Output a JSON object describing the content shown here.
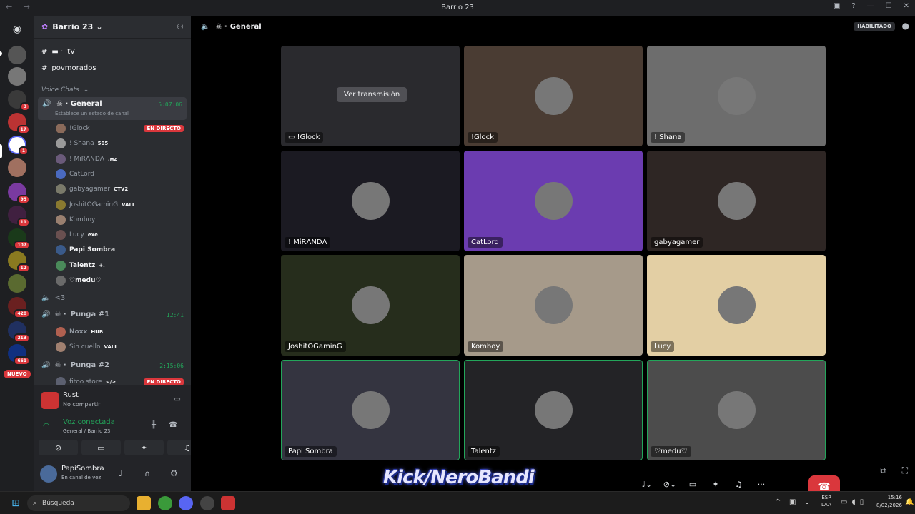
{
  "window": {
    "title": "Barrio 23",
    "nav": "← →"
  },
  "server": {
    "name": "Barrio 23"
  },
  "channels": {
    "text1": "tV",
    "text2": "povmorados",
    "category": "Voice Chats",
    "lowest": "<3"
  },
  "general": {
    "name": "General",
    "time": "5:07:06",
    "status": "Establece un estado de canal",
    "live": "EN DIRECTO"
  },
  "voice_users": [
    {
      "name": "!Glock",
      "tag": "",
      "live": "EN DIRECTO"
    },
    {
      "name": "! Shana",
      "tag": "505"
    },
    {
      "name": "! MiRΛNDΛ",
      "tag": ".ᴍᴢ"
    },
    {
      "name": "CatLord",
      "tag": ""
    },
    {
      "name": "gabyagamer",
      "tag": "CTV2"
    },
    {
      "name": "JoshitOGaminG",
      "tag": "VALL"
    },
    {
      "name": "Komboy",
      "tag": ""
    },
    {
      "name": "Lucy",
      "tag": "exe"
    },
    {
      "name": "Papi Sombra",
      "tag": ""
    },
    {
      "name": "Talentz",
      "tag": "+."
    },
    {
      "name": "♡medu♡",
      "tag": ""
    }
  ],
  "punga1": {
    "name": "Punga #1",
    "time": "12:41",
    "users": [
      {
        "name": "Noxx",
        "tag": "HUB"
      },
      {
        "name": "Sin cuello",
        "tag": "VALL"
      }
    ]
  },
  "punga2": {
    "name": "Punga #2",
    "time": "2:15:06",
    "users": [
      {
        "name": "fitoo store",
        "tag": "</>",
        "live": "EN DIRECTO"
      }
    ]
  },
  "rail_badges": [
    "3",
    "17",
    "1",
    "95",
    "11",
    "107",
    "12",
    "420",
    "213",
    "661"
  ],
  "rail_new": "NUEVO",
  "activity": {
    "name": "Rust",
    "sub": "No compartir"
  },
  "voice_status": {
    "title": "Voz conectada",
    "channel": "General / Barrio 23"
  },
  "user": {
    "name": "PapiSombra",
    "status": "En canal de voz"
  },
  "main": {
    "channel": "General",
    "enabled": "HABILITADO",
    "watch": "Ver transmisión"
  },
  "tiles": [
    {
      "name": "!Glock",
      "bg": "#2a2a2e",
      "stream": true
    },
    {
      "name": "!Glock",
      "bg": "#4a3c33"
    },
    {
      "name": "! Shana",
      "bg": "#6d6d6d"
    },
    {
      "name": "! MiRΛNDΛ",
      "bg": "#1b1a22"
    },
    {
      "name": "CatLord",
      "bg": "#6b3cb0"
    },
    {
      "name": "gabyagamer",
      "bg": "#2e2624"
    },
    {
      "name": "JoshitOGaminG",
      "bg": "#262d1c"
    },
    {
      "name": "Komboy",
      "bg": "#a69a8a"
    },
    {
      "name": "Lucy",
      "bg": "#e3cfa4"
    },
    {
      "name": "Papi Sombra",
      "bg": "#343440",
      "speaking": true
    },
    {
      "name": "Talentz",
      "bg": "#232326",
      "speaking": true
    },
    {
      "name": "♡medu♡",
      "bg": "#4c4c4c",
      "speaking": true
    }
  ],
  "overlay": {
    "kick": "Kick/NeroBandi"
  },
  "taskbar": {
    "search": "Búsqueda",
    "lang1": "ESP",
    "lang2": "LAA",
    "time": "15:16",
    "date": "8/02/2026"
  }
}
